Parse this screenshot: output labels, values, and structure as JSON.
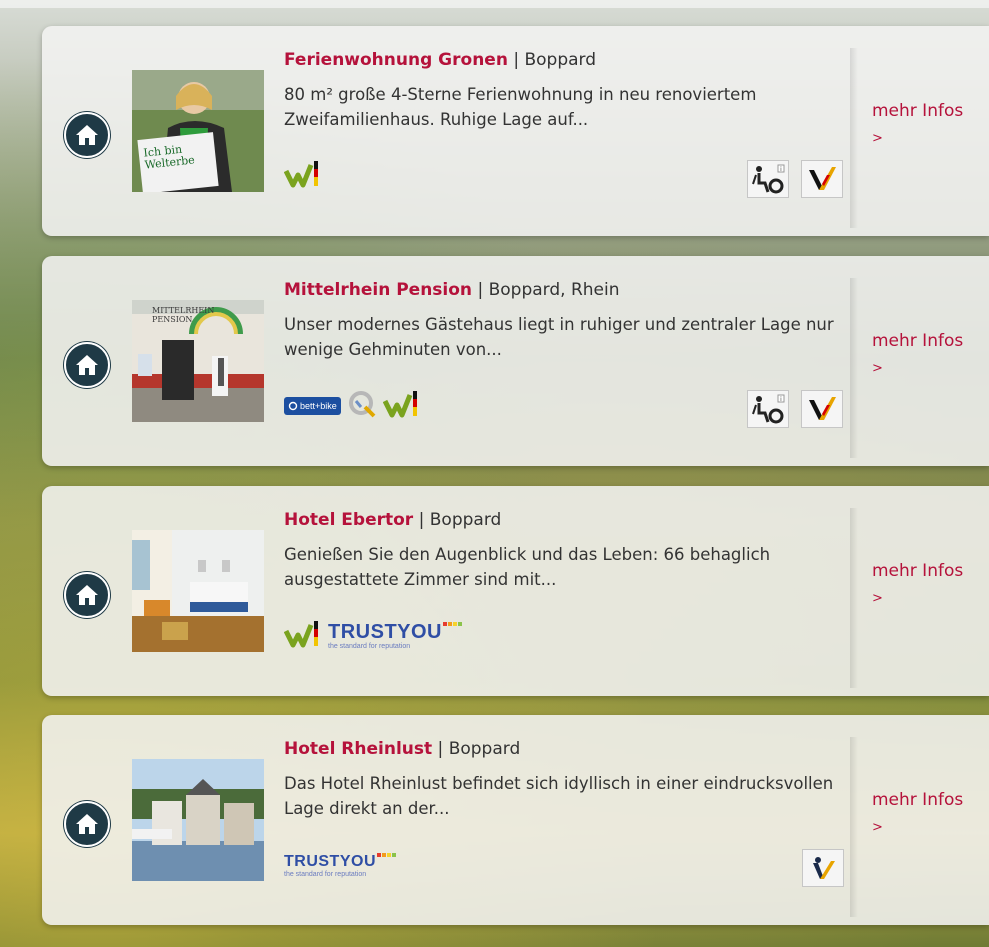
{
  "listings": [
    {
      "name": "Ferienwohnung Gronen",
      "location": "Boppard",
      "description": "80 m² große 4-Sterne Ferienwohnung in neu renoviertem Zweifamilienhaus. Ruhige Lage auf...",
      "photo_sign_text": "Ich bin Welterbe",
      "more_label": "mehr Infos",
      "more_arrow": ">"
    },
    {
      "name": "Mittelrhein Pension",
      "location": "Boppard, Rhein",
      "description": "Unser modernes Gästehaus liegt in ruhiger und zentraler Lage nur wenige Gehminuten von...",
      "photo_sign_text": "MITTELRHEIN PENSION",
      "bett_bike_label": "bett+bike",
      "more_label": "mehr Infos",
      "more_arrow": ">"
    },
    {
      "name": "Hotel Ebertor",
      "location": "Boppard",
      "description": "Genießen Sie den Augenblick und das Leben: 66 behaglich ausgestattete Zimmer sind mit...",
      "trustyou_label": "TRUSTYOU",
      "trustyou_tagline": "the standard for reputation",
      "more_label": "mehr Infos",
      "more_arrow": ">"
    },
    {
      "name": "Hotel Rheinlust",
      "location": "Boppard",
      "description": "Das Hotel Rheinlust befindet sich idyllisch in einer eindrucksvollen Lage direkt an der...",
      "trustyou_label": "TRUSTYOU",
      "trustyou_tagline": "the standard for reputation",
      "more_label": "mehr Infos",
      "more_arrow": ">"
    }
  ],
  "title_separator": " | ",
  "colors": {
    "accent": "#b5123b",
    "home_icon_bg": "#1f3a46",
    "trustyou": "#2f4ea5"
  },
  "icons": [
    "home-icon",
    "wheelchair-accessibility-icon",
    "v-check-icon",
    "welterbe-logo",
    "q-quality-logo",
    "bett-bike-logo",
    "trustyou-logo"
  ]
}
